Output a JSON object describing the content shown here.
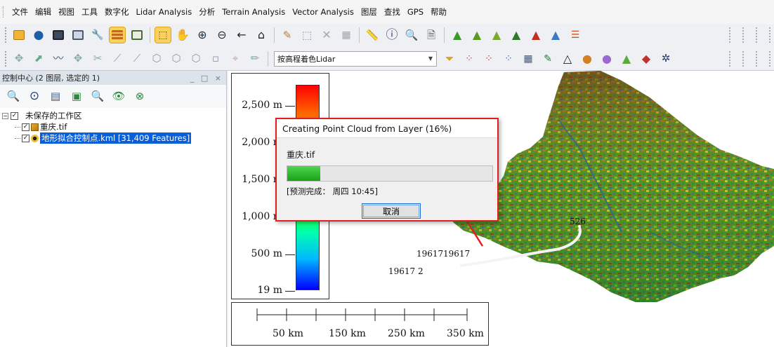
{
  "menu": [
    "文件",
    "编辑",
    "视图",
    "工具",
    "数字化",
    "Lidar Analysis",
    "分析",
    "Terrain Analysis",
    "Vector Analysis",
    "图层",
    "查找",
    "GPS",
    "帮助"
  ],
  "toolbar": {
    "lidar_mode_select": "按高程着色Lidar"
  },
  "panel": {
    "title": "控制中心  (2 图层, 选定的 1)",
    "window_controls": "_ □ ×",
    "tree": {
      "workspace": "未保存的工作区",
      "layers": [
        {
          "name": "重庆.tif",
          "checked": true,
          "selected": false
        },
        {
          "name": "地形拟合控制点.kml [31,409 Features]",
          "checked": true,
          "selected": true
        }
      ]
    }
  },
  "legend": {
    "labels": [
      "2,500 m",
      "2,000 m",
      "1,500 m",
      "1,000 m",
      "500 m",
      "19 m"
    ]
  },
  "scalebar": {
    "labels": [
      "50 km",
      "150 km",
      "250 km",
      "350 km"
    ]
  },
  "map_labels": {
    "label_a": "19617",
    "label_b": "19617",
    "label_c": "19617 2",
    "label_d": "526"
  },
  "dialog": {
    "title": "Creating Point Cloud from Layer (16%)",
    "file": "重庆.tif",
    "progress_fraction": 0.16,
    "eta": "[预测完成：  周四 10:45]",
    "cancel": "取消"
  },
  "colors": {
    "accent_red": "#e02020",
    "progress_green": "#17a317",
    "selection_blue": "#0a5fd8"
  }
}
